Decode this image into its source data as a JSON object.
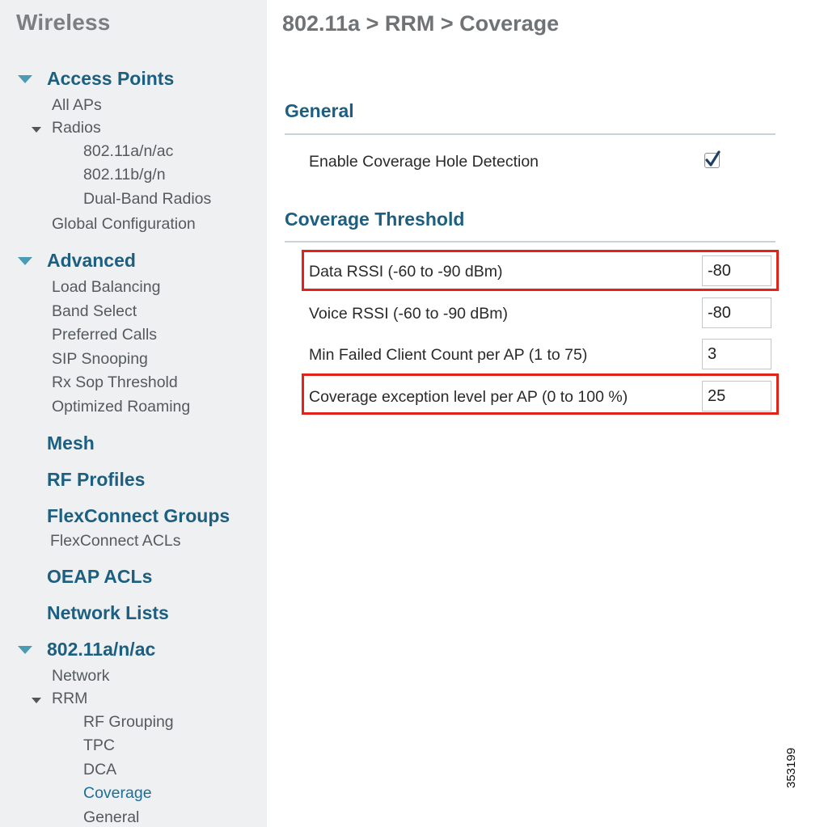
{
  "sidebar": {
    "title": "Wireless",
    "sections": {
      "access_points": "Access Points",
      "all_aps": "All APs",
      "radios": "Radios",
      "radio_a": "802.11a/n/ac",
      "radio_b": "802.11b/g/n",
      "dual_band": "Dual-Band Radios",
      "global_config": "Global Configuration",
      "advanced": "Advanced",
      "load_balancing": "Load Balancing",
      "band_select": "Band Select",
      "preferred_calls": "Preferred Calls",
      "sip_snooping": "SIP Snooping",
      "rx_sop": "Rx Sop Threshold",
      "optimized_roaming": "Optimized Roaming",
      "mesh": "Mesh",
      "rf_profiles": "RF Profiles",
      "flexconnect_groups": "FlexConnect Groups",
      "flexconnect_acls": "FlexConnect ACLs",
      "oeap_acls": "OEAP ACLs",
      "network_lists": "Network Lists",
      "band_80211a": "802.11a/n/ac",
      "network": "Network",
      "rrm": "RRM",
      "rf_grouping": "RF Grouping",
      "tpc": "TPC",
      "dca": "DCA",
      "coverage": "Coverage",
      "general": "General"
    }
  },
  "main": {
    "breadcrumb": "802.11a > RRM > Coverage",
    "general_heading": "General",
    "enable_label": "Enable Coverage Hole Detection",
    "enable_checked": true,
    "threshold_heading": "Coverage Threshold",
    "fields": {
      "data_rssi": {
        "label": "Data RSSI (-60 to -90 dBm)",
        "value": "-80"
      },
      "voice_rssi": {
        "label": "Voice RSSI (-60 to -90 dBm)",
        "value": "-80"
      },
      "min_failed": {
        "label": "Min Failed Client Count per AP (1 to 75)",
        "value": "3"
      },
      "exception_level": {
        "label": "Coverage exception level per AP (0 to 100 %)",
        "value": "25"
      }
    }
  },
  "figure_id": "353199",
  "colors": {
    "sidebar_bg": "#eef0f1",
    "section_blue": "#1d5f80",
    "highlight_red": "#e2231a",
    "triangle_teal": "#4a9bb4"
  }
}
